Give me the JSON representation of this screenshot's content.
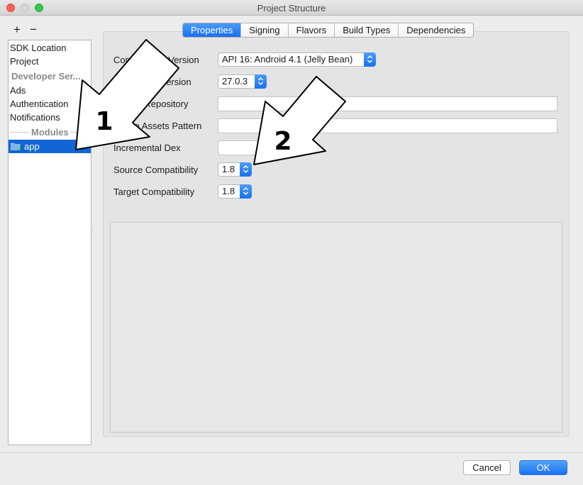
{
  "window": {
    "title": "Project Structure"
  },
  "toolbar": {
    "add_label": "+",
    "remove_label": "−"
  },
  "sidebar": {
    "items": [
      {
        "label": "SDK Location"
      },
      {
        "label": "Project"
      },
      {
        "label": "Developer Ser..."
      },
      {
        "label": "Ads"
      },
      {
        "label": "Authentication"
      },
      {
        "label": "Notifications"
      }
    ],
    "modules_header": "Modules",
    "module_app": "app",
    "selected_color": "#1265d4"
  },
  "tabs": [
    {
      "label": "Properties",
      "active": true
    },
    {
      "label": "Signing"
    },
    {
      "label": "Flavors"
    },
    {
      "label": "Build Types"
    },
    {
      "label": "Dependencies"
    }
  ],
  "form": {
    "compile_sdk_label": "Compile Sdk Version",
    "compile_sdk_value": "API 16: Android 4.1 (Jelly Bean)",
    "build_tools_label": "Build Tools Version",
    "build_tools_value": "27.0.3",
    "library_repo_label": "Library Repository",
    "ignore_assets_label": "Ignore Assets Pattern",
    "incremental_dex_label": "Incremental Dex",
    "source_compat_label": "Source Compatibility",
    "source_compat_value": "1.8",
    "target_compat_label": "Target Compatibility",
    "target_compat_value": "1.8"
  },
  "footer": {
    "cancel_label": "Cancel",
    "ok_label": "OK"
  },
  "annotations": {
    "arrow_1_number": "1",
    "arrow_2_number": "2"
  },
  "colors": {
    "accent": "#1a6ff0",
    "selection": "#1265d4"
  }
}
